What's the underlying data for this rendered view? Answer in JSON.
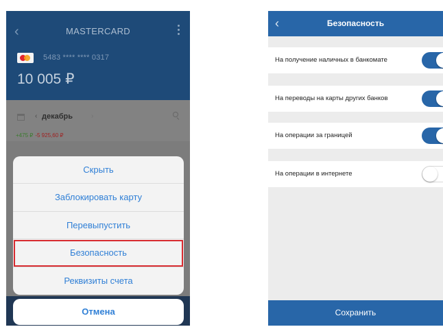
{
  "left_screen": {
    "header": {
      "back_icon": "chevron-left-icon",
      "title": "MASTERCARD",
      "menu_icon": "more-vertical-icon",
      "card_number": "5483 **** **** 0317",
      "balance": "10 005 ₽"
    },
    "filter": {
      "calendar_icon": "calendar-icon",
      "prev_icon": "‹",
      "month": "декабрь",
      "next_icon": "›",
      "search_icon": "search-icon",
      "income": "+475 ₽",
      "expense": "-5 925,60 ₽"
    },
    "action_sheet": {
      "items": [
        {
          "label": "Скрыть"
        },
        {
          "label": "Заблокировать карту"
        },
        {
          "label": "Перевыпустить"
        },
        {
          "label": "Безопасность",
          "highlighted": true
        },
        {
          "label": "Реквизиты счета"
        }
      ],
      "cancel_label": "Отмена"
    },
    "colors": {
      "header": "#1e4a78",
      "link": "#2f7fd6",
      "highlight": "#d72a2f"
    }
  },
  "right_screen": {
    "header": {
      "back_icon": "chevron-left-icon",
      "title": "Безопасность"
    },
    "settings": [
      {
        "label": "На получение наличных в банкомате",
        "enabled": true
      },
      {
        "label": "На переводы на карты других банков",
        "enabled": true
      },
      {
        "label": "На операции за границей",
        "enabled": true
      },
      {
        "label": "На операции в интернете",
        "enabled": false
      }
    ],
    "save_label": "Сохранить",
    "colors": {
      "primary": "#2866a8"
    }
  }
}
